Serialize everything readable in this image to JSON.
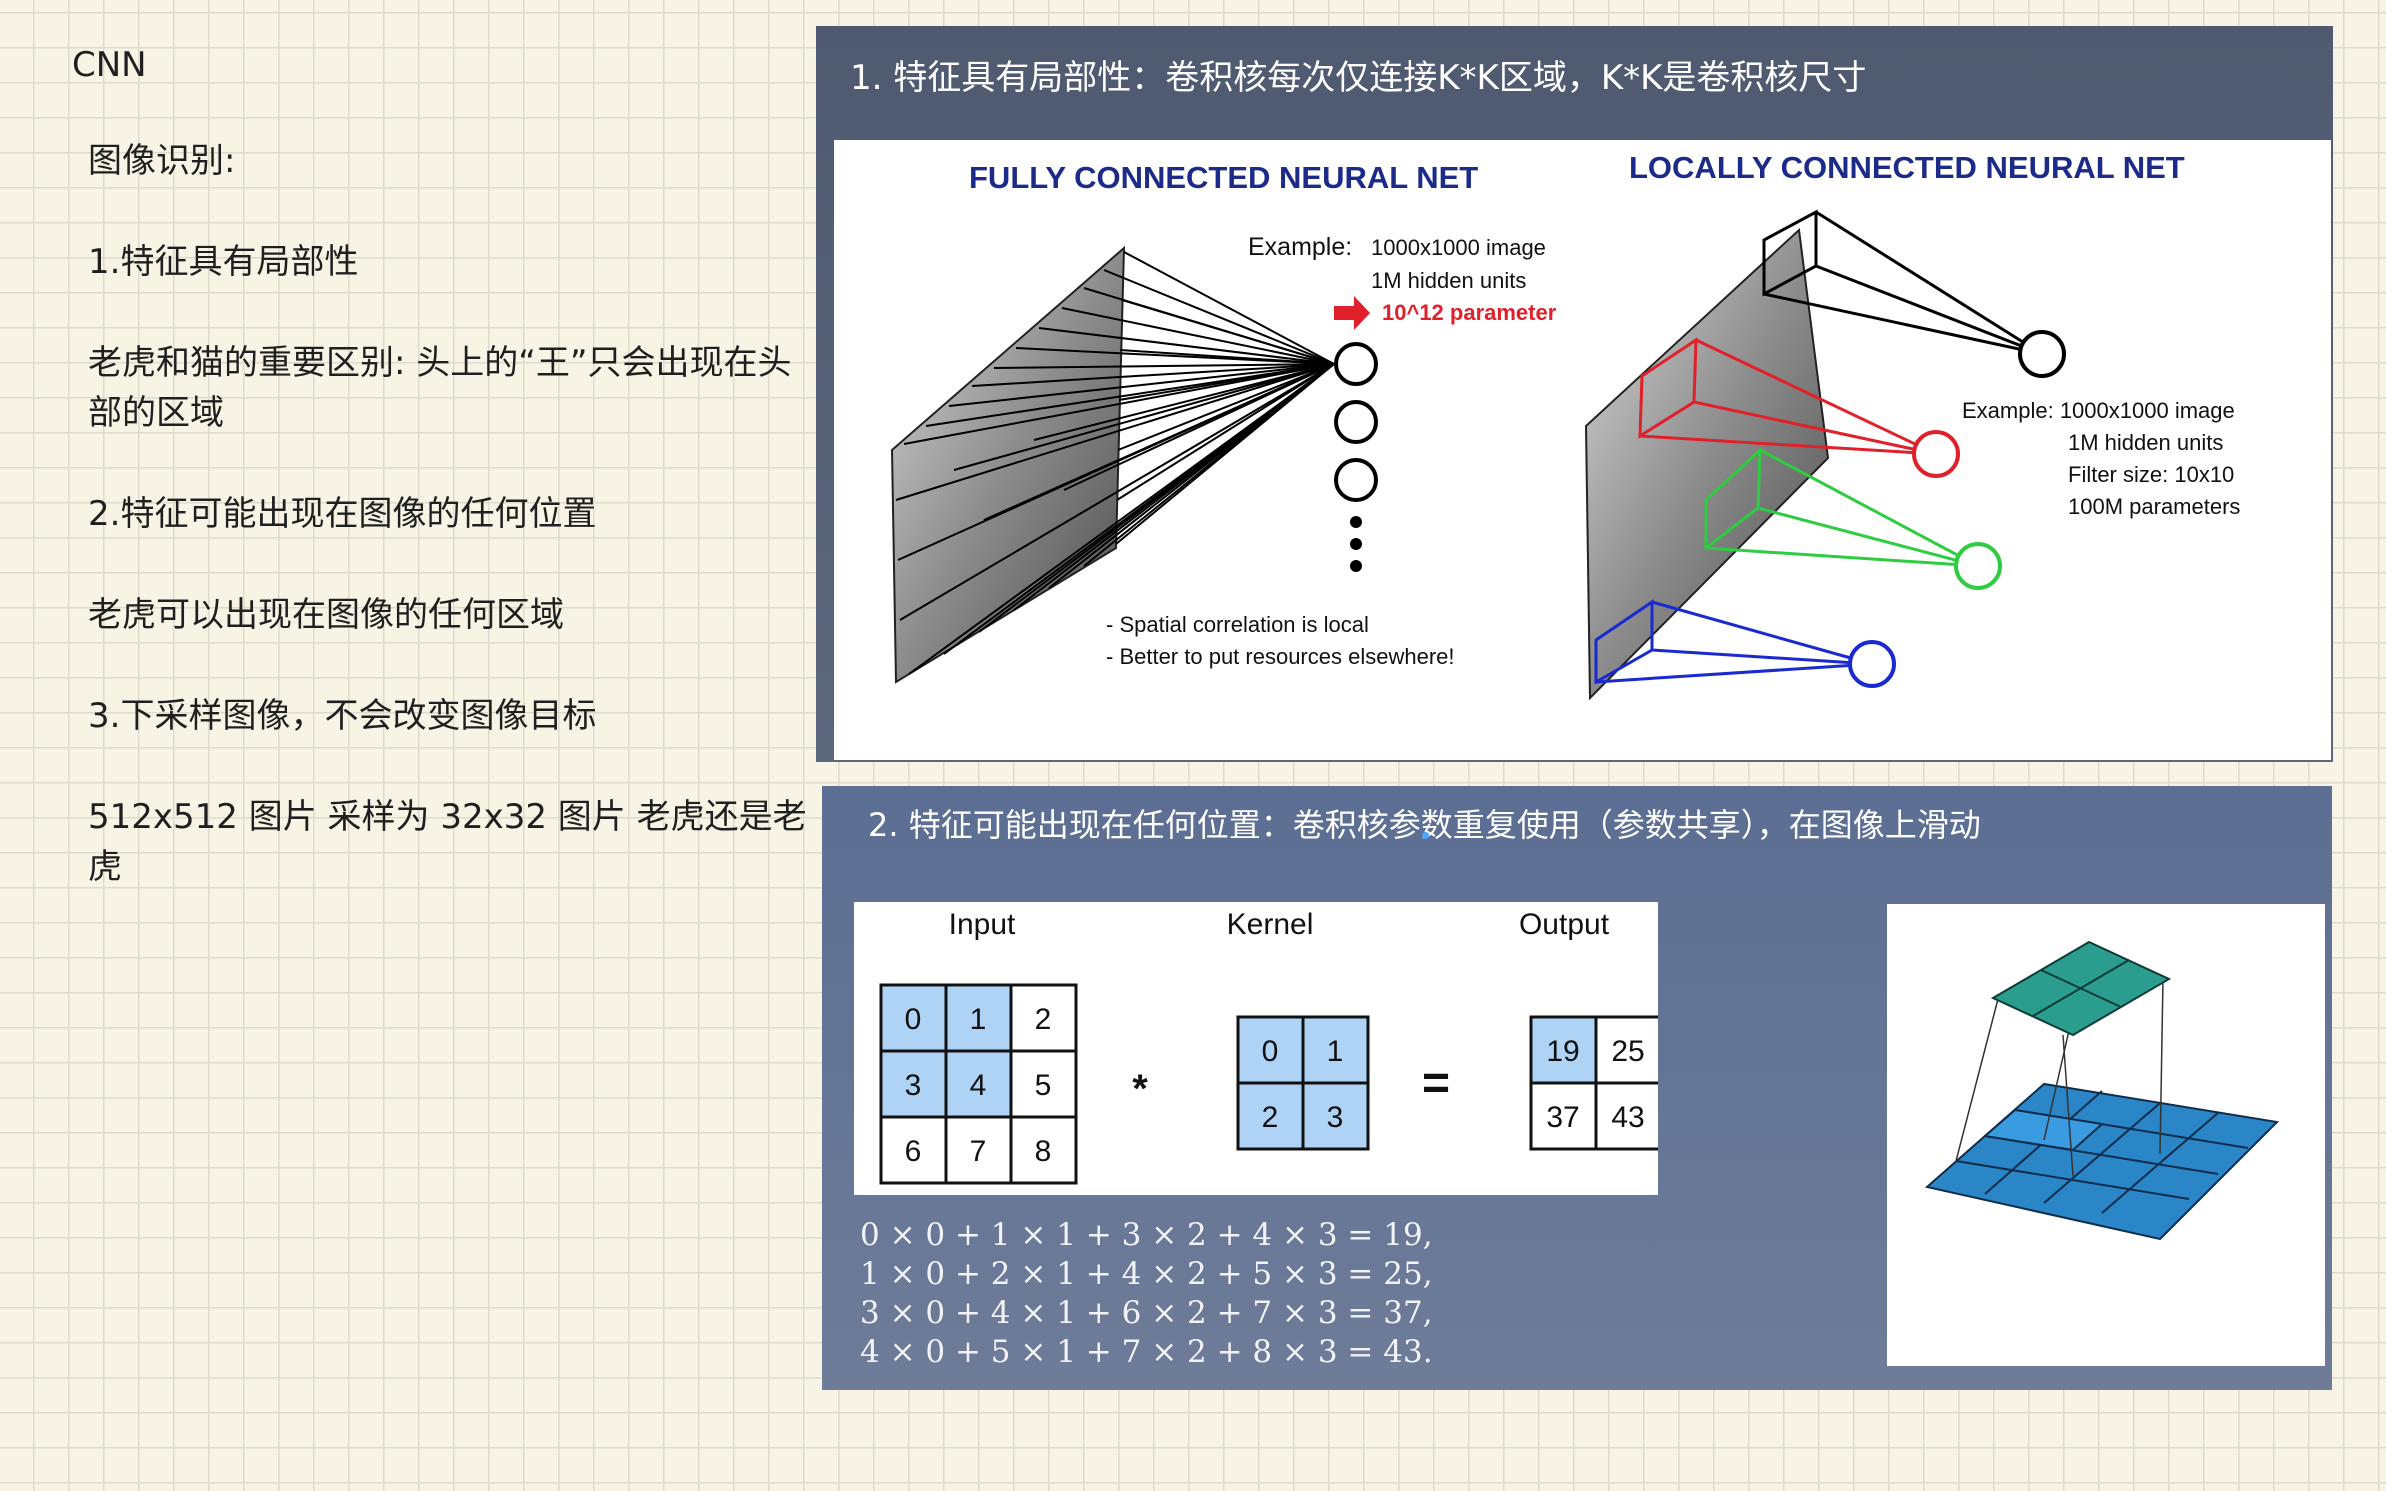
{
  "notes": {
    "title": "CNN",
    "lines": [
      "图像识别:",
      "1.特征具有局部性",
      "老虎和猫的重要区别: 头上的“王”只会出现在头部的区域",
      "2.特征可能出现在图像的任何位置",
      "老虎可以出现在图像的任何区域",
      "3.下采样图像，不会改变图像目标",
      "512x512 图片 采样为 32x32 图片 老虎还是老虎"
    ]
  },
  "slide1": {
    "title": "1. 特征具有局部性：卷积核每次仅连接K*K区域，K*K是卷积核尺寸",
    "figure": {
      "fully_title": "FULLY CONNECTED NEURAL NET",
      "locally_title": "LOCALLY CONNECTED NEURAL NET",
      "fully_example": [
        "Example:",
        "1000x1000 image",
        "1M hidden units",
        "10^12 parameter"
      ],
      "notes": [
        "- Spatial correlation is local",
        "- Better to put resources elsewhere!"
      ],
      "locally_example": [
        "Example: 1000x1000 image",
        "1M hidden units",
        "Filter size: 10x10",
        "100M parameters"
      ],
      "colors": {
        "title": "#1c2a8a",
        "red": "#e0202a",
        "green": "#2ecc40",
        "blue": "#1a2ad0"
      }
    }
  },
  "slide2": {
    "title": "2. 特征可能出现在任何位置：卷积核参数重复使用（参数共享），在图像上滑动",
    "conv": {
      "input_label": "Input",
      "kernel_label": "Kernel",
      "output_label": "Output",
      "input": [
        [
          "0",
          "1",
          "2"
        ],
        [
          "3",
          "4",
          "5"
        ],
        [
          "6",
          "7",
          "8"
        ]
      ],
      "kernel": [
        [
          "0",
          "1"
        ],
        [
          "2",
          "3"
        ]
      ],
      "output": [
        [
          "19",
          "25"
        ],
        [
          "37",
          "43"
        ]
      ],
      "op": "*",
      "eq": "=",
      "highlight": "#aed3f5"
    },
    "equations": [
      "0 × 0 + 1 × 1 + 3 × 2 + 4 × 3 = 19,",
      "1 × 0 + 2 × 1 + 4 × 2 + 5 × 3 = 25,",
      "3 × 0 + 4 × 1 + 6 × 2 + 7 × 3 = 37,",
      "4 × 0 + 5 × 1 + 7 × 2 + 8 × 3 = 43."
    ],
    "mini_colors": {
      "top": "#2a9d8f",
      "base": "#2b86c8"
    }
  }
}
